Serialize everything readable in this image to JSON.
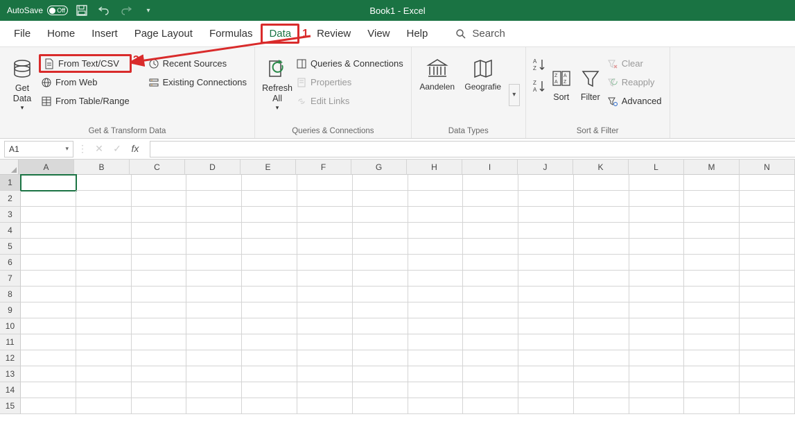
{
  "titlebar": {
    "autosave_label": "AutoSave",
    "autosave_state": "Off",
    "doc_title": "Book1  -  Excel"
  },
  "tabs": {
    "file": "File",
    "home": "Home",
    "insert": "Insert",
    "page_layout": "Page Layout",
    "formulas": "Formulas",
    "data": "Data",
    "review": "Review",
    "view": "View",
    "help": "Help",
    "search": "Search"
  },
  "ribbon": {
    "get_transform": {
      "get_data": "Get\nData",
      "from_text_csv": "From Text/CSV",
      "from_web": "From Web",
      "from_table_range": "From Table/Range",
      "recent_sources": "Recent Sources",
      "existing_connections": "Existing Connections",
      "group_label": "Get & Transform Data"
    },
    "qc": {
      "refresh_all": "Refresh\nAll",
      "queries_connections": "Queries & Connections",
      "properties": "Properties",
      "edit_links": "Edit Links",
      "group_label": "Queries & Connections"
    },
    "data_types": {
      "stocks": "Aandelen",
      "geography": "Geografie",
      "group_label": "Data Types"
    },
    "sort_filter": {
      "sort": "Sort",
      "filter": "Filter",
      "clear": "Clear",
      "reapply": "Reapply",
      "advanced": "Advanced",
      "group_label": "Sort & Filter"
    }
  },
  "annotations": {
    "marker1": "1",
    "marker2": "2"
  },
  "formula_bar": {
    "name_box": "A1",
    "fx_label": "fx"
  },
  "grid": {
    "columns": [
      "A",
      "B",
      "C",
      "D",
      "E",
      "F",
      "G",
      "H",
      "I",
      "J",
      "K",
      "L",
      "M",
      "N"
    ],
    "rows": [
      1,
      2,
      3,
      4,
      5,
      6,
      7,
      8,
      9,
      10,
      11,
      12,
      13,
      14,
      15
    ],
    "active_cell": "A1"
  }
}
